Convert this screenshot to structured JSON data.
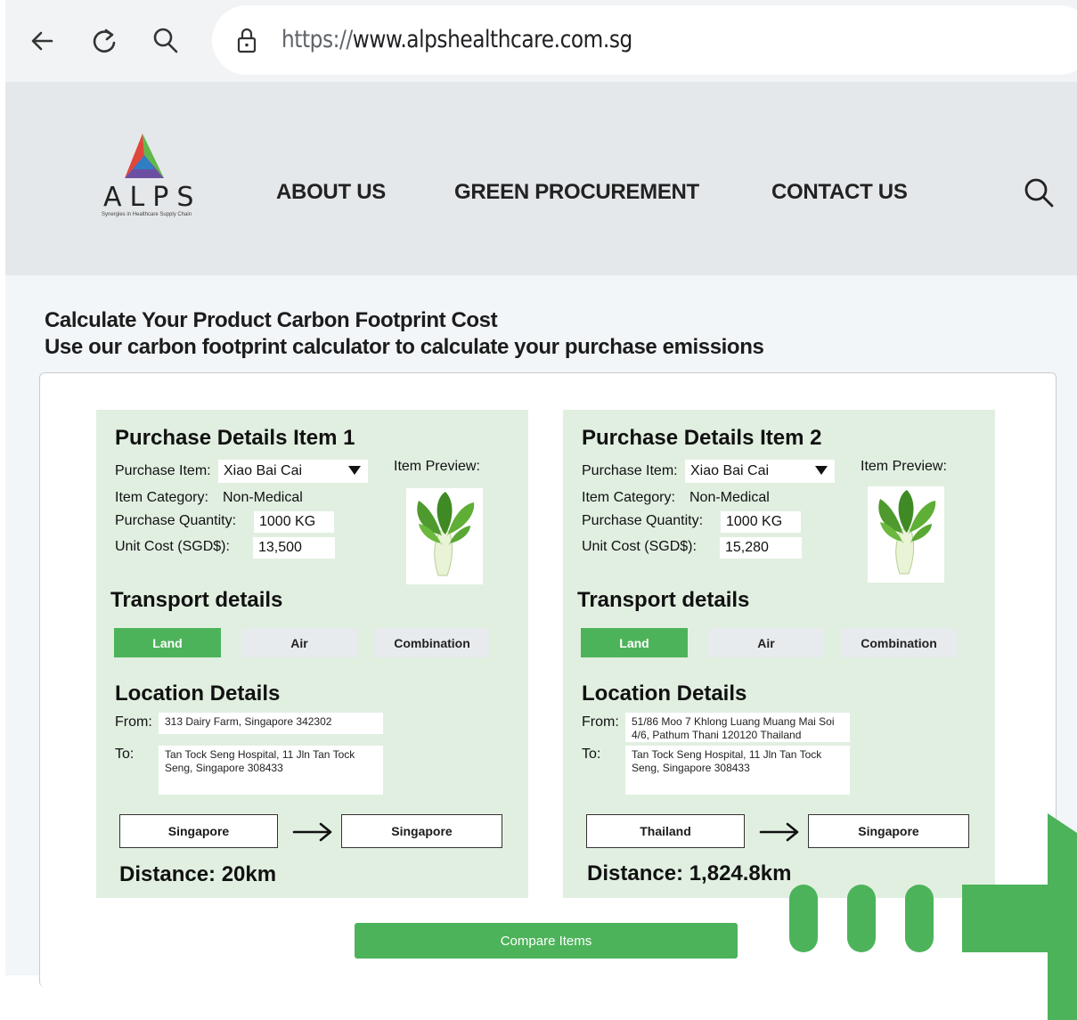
{
  "browser": {
    "url_scheme": "https://",
    "url_host": "www.alpshealthcare.com.sg",
    "icons": [
      "back-arrow-icon",
      "reload-icon",
      "search-icon",
      "lock-icon"
    ]
  },
  "header": {
    "logo_text": "ALPS",
    "logo_tagline": "Synergies in Healthcare Supply Chain",
    "menu": [
      "ABOUT US",
      "GREEN PROCUREMENT",
      "CONTACT US"
    ]
  },
  "page": {
    "title": "Calculate Your Product Carbon Footprint Cost",
    "subtitle": "Use our carbon footprint calculator to calculate your purchase emissions",
    "compare_label": "Compare Items"
  },
  "items": [
    {
      "title": "Purchase Details Item 1",
      "purchase_item_label": "Purchase Item:",
      "purchase_item_value": "Xiao Bai Cai",
      "preview_label": "Item Preview:",
      "category_label": "Item Category:",
      "category_value": "Non-Medical",
      "quantity_label": "Purchase Quantity:",
      "quantity_value": "1000 KG",
      "unit_cost_label": "Unit Cost (SGD$):",
      "unit_cost_value": "13,500",
      "transport_title": "Transport details",
      "transport_options": [
        "Land",
        "Air",
        "Combination"
      ],
      "transport_selected": "Land",
      "location_title": "Location Details",
      "from_label": "From:",
      "from_value": "313 Dairy Farm, Singapore 342302",
      "to_label": "To:",
      "to_value": "Tan Tock Seng Hospital, 11 Jln Tan Tock Seng, Singapore 308433",
      "origin_country": "Singapore",
      "destination_country": "Singapore",
      "distance": "Distance: 20km"
    },
    {
      "title": "Purchase Details Item 2",
      "purchase_item_label": "Purchase Item:",
      "purchase_item_value": "Xiao Bai Cai",
      "preview_label": "Item Preview:",
      "category_label": "Item Category:",
      "category_value": "Non-Medical",
      "quantity_label": "Purchase Quantity:",
      "quantity_value": "1000 KG",
      "unit_cost_label": "Unit Cost (SGD$):",
      "unit_cost_value": "15,280",
      "transport_title": "Transport details",
      "transport_options": [
        "Land",
        "Air",
        "Combination"
      ],
      "transport_selected": "Land",
      "location_title": "Location Details",
      "from_label": "From:",
      "from_value": "51/86 Moo 7 Khlong Luang Muang Mai Soi 4/6, Pathum Thani 120120 Thailand",
      "to_label": "To:",
      "to_value": "Tan Tock Seng Hospital, 11 Jln Tan Tock Seng, Singapore 308433",
      "origin_country": "Thailand",
      "destination_country": "Singapore",
      "distance": "Distance: 1,824.8km"
    }
  ],
  "colors": {
    "accent_green": "#4db35a",
    "card_bg": "#e1efe1",
    "header_bg": "#e5e8ea"
  }
}
